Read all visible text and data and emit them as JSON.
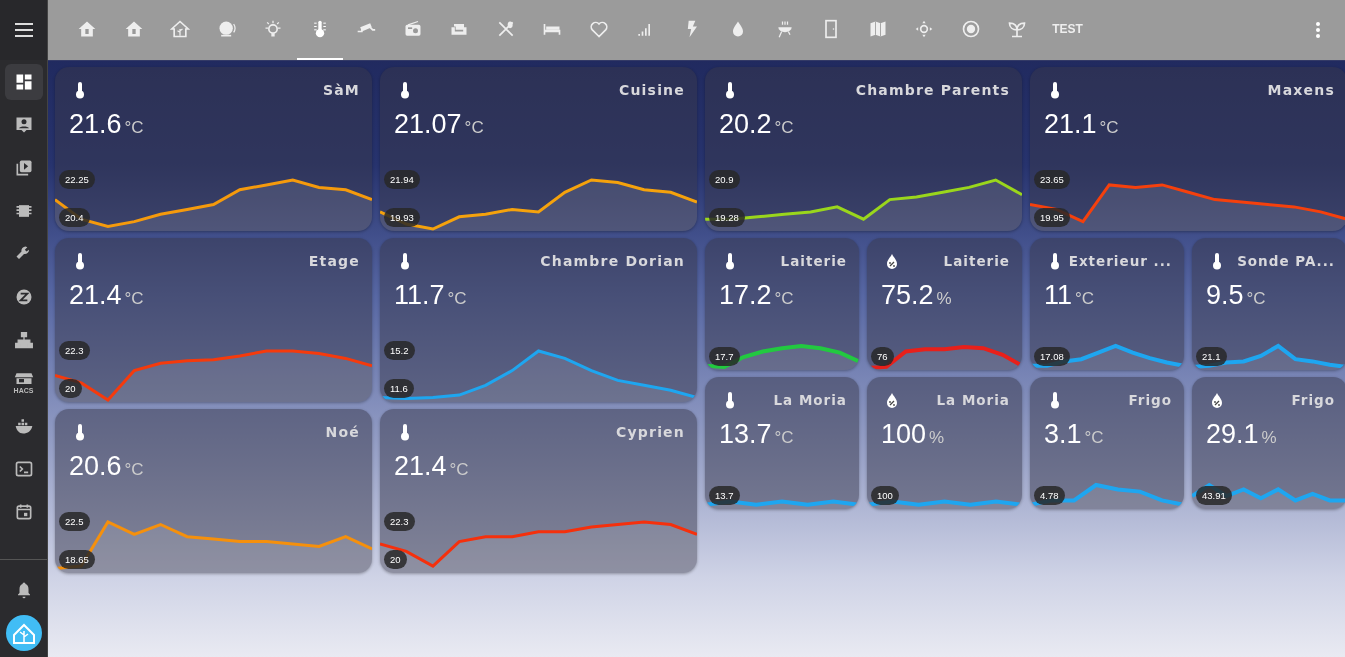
{
  "sidebar": {
    "items": [
      {
        "selected": true
      },
      {
        "selected": false
      },
      {
        "selected": false
      },
      {
        "selected": false
      },
      {
        "selected": false
      },
      {
        "selected": false
      },
      {
        "selected": false
      },
      {
        "selected": false,
        "label": "HACS"
      },
      {
        "selected": false
      },
      {
        "selected": false
      },
      {
        "selected": false
      }
    ]
  },
  "tabs": [
    {
      "kind": "icon",
      "selected": false
    },
    {
      "kind": "icon",
      "selected": false
    },
    {
      "kind": "icon",
      "selected": false
    },
    {
      "kind": "icon",
      "selected": false
    },
    {
      "kind": "icon",
      "selected": false
    },
    {
      "kind": "icon",
      "selected": true
    },
    {
      "kind": "icon",
      "selected": false
    },
    {
      "kind": "icon",
      "selected": false
    },
    {
      "kind": "icon",
      "selected": false
    },
    {
      "kind": "icon",
      "selected": false
    },
    {
      "kind": "icon",
      "selected": false
    },
    {
      "kind": "icon",
      "selected": false
    },
    {
      "kind": "icon",
      "selected": false
    },
    {
      "kind": "icon",
      "selected": false
    },
    {
      "kind": "icon",
      "selected": false
    },
    {
      "kind": "icon",
      "selected": false
    },
    {
      "kind": "icon",
      "selected": false
    },
    {
      "kind": "icon",
      "selected": false
    },
    {
      "kind": "icon",
      "selected": false
    },
    {
      "kind": "icon",
      "selected": false
    },
    {
      "kind": "icon",
      "selected": false
    },
    {
      "kind": "text",
      "label": "TEST",
      "selected": false
    }
  ],
  "panels": [
    {
      "large_cards": [
        {
          "kind": "temperature",
          "name": "SàM",
          "value": "21.6",
          "unit": "°C",
          "labels": [
            "22.25",
            "20.4"
          ],
          "color": "#f59a0c"
        },
        {
          "kind": "temperature",
          "name": "Cuisine",
          "value": "21.07",
          "unit": "°C",
          "labels": [
            "21.94",
            "19.93"
          ],
          "color": "#f5a20c"
        },
        {
          "kind": "temperature",
          "name": "Etage",
          "value": "21.4",
          "unit": "°C",
          "labels": [
            "22.3",
            "20"
          ],
          "color": "#f53a0c"
        },
        {
          "kind": "temperature",
          "name": "Chambre Dorian",
          "value": "11.7",
          "unit": "°C",
          "labels": [
            "15.2",
            "11.6"
          ],
          "color": "#1ea6f0"
        },
        {
          "kind": "temperature",
          "name": "Noé",
          "value": "20.6",
          "unit": "°C",
          "labels": [
            "22.5",
            "18.65"
          ],
          "color": "#f5900c"
        },
        {
          "kind": "temperature",
          "name": "Cyprien",
          "value": "21.4",
          "unit": "°C",
          "labels": [
            "22.3",
            "20"
          ],
          "color": "#f5300c"
        }
      ]
    },
    {
      "large_cards": [
        {
          "kind": "temperature",
          "name": "Chambre Parents",
          "value": "20.2",
          "unit": "°C",
          "labels": [
            "20.9",
            "19.28"
          ],
          "color": "#9ad61c"
        },
        {
          "kind": "temperature",
          "name": "Maxens",
          "value": "21.1",
          "unit": "°C",
          "labels": [
            "23.65",
            "19.95"
          ],
          "color": "#f5400c"
        }
      ],
      "small_cards": [
        {
          "kind": "temperature",
          "name": "Laiterie",
          "value": "17.2",
          "unit": "°C",
          "labels": [
            "17.7"
          ],
          "color": "#22c940"
        },
        {
          "kind": "humidity",
          "name": "Laiterie",
          "value": "75.2",
          "unit": "%",
          "labels": [
            "76"
          ],
          "color": "#e8201a"
        },
        {
          "kind": "temperature",
          "name": "Exterieur ...",
          "value": "11",
          "unit": "°C",
          "labels": [
            "17.08"
          ],
          "color": "#1ea6f0"
        },
        {
          "kind": "temperature",
          "name": "Sonde PA...",
          "value": "9.5",
          "unit": "°C",
          "labels": [
            "21.1"
          ],
          "color": "#1ea6f0"
        },
        {
          "kind": "temperature",
          "name": "La Moria",
          "value": "13.7",
          "unit": "°C",
          "labels": [
            "13.7"
          ],
          "color": "#1ea6f0"
        },
        {
          "kind": "humidity",
          "name": "La Moria",
          "value": "100",
          "unit": "%",
          "labels": [
            "100"
          ],
          "color": "#1ea6f0"
        },
        {
          "kind": "temperature",
          "name": "Frigo",
          "value": "3.1",
          "unit": "°C",
          "labels": [
            "4.78"
          ],
          "color": "#1ea6f0"
        },
        {
          "kind": "humidity",
          "name": "Frigo",
          "value": "29.1",
          "unit": "%",
          "labels": [
            "43.91"
          ],
          "color": "#1ea6f0"
        }
      ]
    }
  ]
}
